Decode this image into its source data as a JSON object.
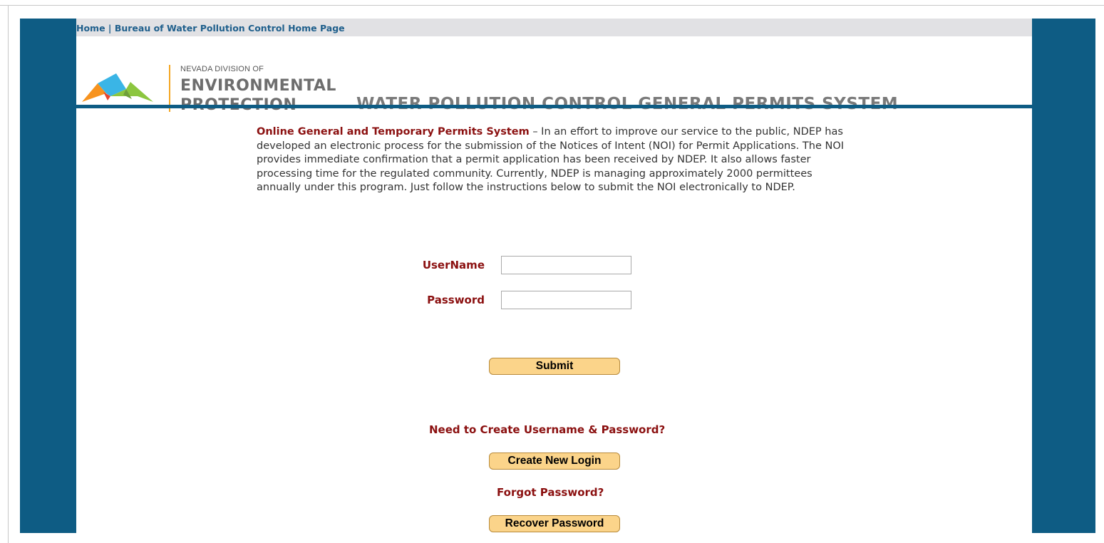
{
  "nav": {
    "home": "Home",
    "separator": " | ",
    "bureau": "Bureau of Water Pollution Control Home Page"
  },
  "logo": {
    "small": "NEVADA DIVISION OF",
    "line1": "ENVIRONMENTAL",
    "line2": "PROTECTION"
  },
  "header": {
    "system_title": "WATER POLLUTION CONTROL GENERAL PERMITS SYSTEM"
  },
  "intro": {
    "lead": "Online General and Temporary Permits System",
    "body": " – In an effort to improve our service to the public, NDEP has developed an electronic process for the submission of the Notices of Intent (NOI) for Permit Applications. The NOI provides immediate confirmation that a permit application has been received by NDEP. It also allows faster processing time for the regulated community. Currently, NDEP is managing approximately 2000 permittees annually under this program. Just follow the instructions below to submit the NOI electronically to NDEP."
  },
  "login": {
    "username_label": "UserName",
    "username_value": "",
    "password_label": "Password",
    "password_value": "",
    "submit_label": "Submit"
  },
  "create": {
    "question": "Need to Create Username & Password?",
    "button_label": "Create New Login"
  },
  "recover": {
    "question": "Forgot Password?",
    "button_label": "Recover Password"
  },
  "colors": {
    "brand_blue": "#0e5c84",
    "accent_red": "#8b1010",
    "button_fill": "#fbd48a",
    "logo_orange": "#f5a623"
  }
}
